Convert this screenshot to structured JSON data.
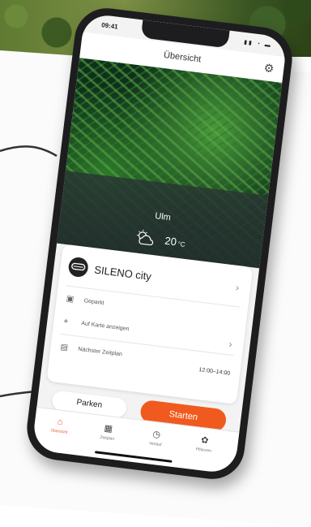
{
  "status": {
    "time": "09:41",
    "icons": "▮▮ ◔ ▬"
  },
  "header": {
    "title": "Übersicht"
  },
  "weather": {
    "city": "Ulm",
    "temperature": "20",
    "unit": "°C"
  },
  "vehicle": {
    "name": "SILENO city"
  },
  "info": {
    "status_label": "Geparkt",
    "map_label": "Auf Karte anzeigen",
    "slot_label": "Nächster Zeitplan",
    "slot_time": "12:00–14:00"
  },
  "actions": {
    "park_label": "Parken",
    "start_label": "Starten"
  },
  "tabs": [
    {
      "label": "Übersicht"
    },
    {
      "label": "Zeitplan"
    },
    {
      "label": "Verlauf"
    },
    {
      "label": "Pflanzen"
    }
  ],
  "colors": {
    "accent": "#f05a1f",
    "hero_dark": "#23302d"
  }
}
